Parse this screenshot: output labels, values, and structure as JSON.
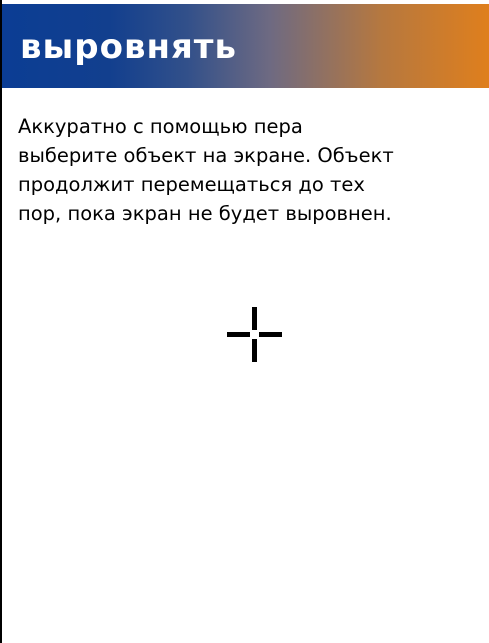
{
  "title_bar": {
    "title": "выровнять"
  },
  "instructions": {
    "lines": [
      "Аккуратно с помощью пера",
      "выберите объект на экране. Объект",
      "продолжит перемещаться до тех",
      "пор, пока экран не будет выровнен."
    ]
  },
  "target": {
    "icon": "crosshair-icon"
  },
  "colors": {
    "title_gradient_start": "#0b3d94",
    "title_gradient_end": "#df7f1d",
    "title_text": "#ffffff",
    "background": "#ffffff",
    "text": "#000000"
  }
}
